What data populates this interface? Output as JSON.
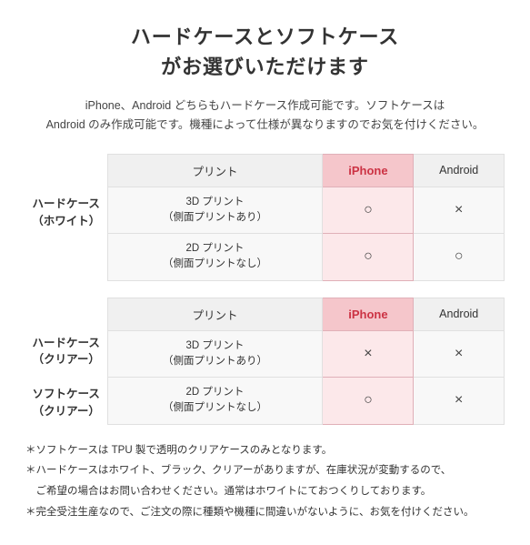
{
  "title_line1": "ハードケースとソフトケース",
  "title_line2": "がお選びいただけます",
  "description": "iPhone、Android どちらもハードケース作成可能です。ソフトケースは\nAndroid のみ作成可能です。機種によって仕様が異なりますのでお気を付けください。",
  "table1": {
    "row_header": "ハードケース\n（ホワイト）",
    "col_print": "プリント",
    "col_iphone": "iPhone",
    "col_android": "Android",
    "rows": [
      {
        "print": "3D プリント\n（側面プリントあり）",
        "iphone": "○",
        "android": "×"
      },
      {
        "print": "2D プリント\n（側面プリントなし）",
        "iphone": "○",
        "android": "○"
      }
    ]
  },
  "table2": {
    "row_header1": "ハードケース\n（クリアー）",
    "row_header2": "ソフトケース\n（クリアー）",
    "col_print": "プリント",
    "col_iphone": "iPhone",
    "col_android": "Android",
    "rows": [
      {
        "print": "3D プリント\n（側面プリントあり）",
        "iphone": "×",
        "android": "×"
      },
      {
        "print": "2D プリント\n（側面プリントなし）",
        "iphone": "○",
        "android": "×"
      }
    ]
  },
  "notes": [
    "＊ソフトケースは TPU 製で透明のクリアケースのみとなります。",
    "＊ハードケースはホワイト、ブラック、クリアーがありますが、在庫状況が変動するので、",
    "　ご希望の場合はお問い合わせください。通常はホワイトにておつくりしております。",
    "＊完全受注生産なので、ご注文の際に種類や機種に間違いがないように、お気を付けください。"
  ]
}
